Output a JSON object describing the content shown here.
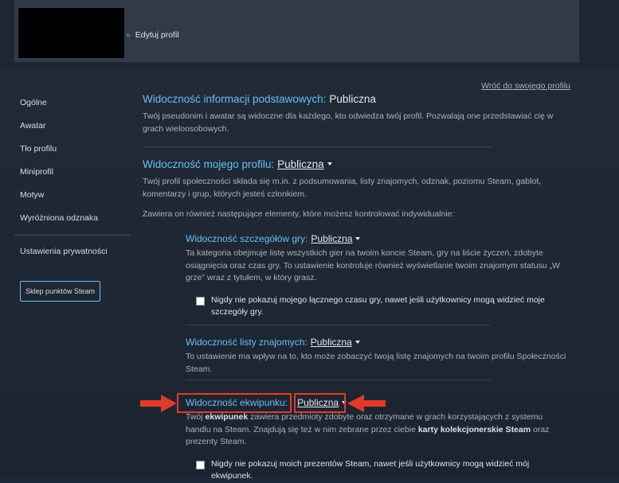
{
  "header": {
    "breadcrumb_sep": "»",
    "breadcrumb": "Edytuj profil"
  },
  "back_link": "Wróć do swojego profilu",
  "sidebar": {
    "items": [
      {
        "label": "Ogólne"
      },
      {
        "label": "Awatar"
      },
      {
        "label": "Tło profilu"
      },
      {
        "label": "Miniprofil"
      },
      {
        "label": "Motyw"
      },
      {
        "label": "Wyróżniona odznaka"
      }
    ],
    "privacy": "Ustawienia prywatności",
    "store_button": "Sklep punktów Steam"
  },
  "sections": {
    "basic": {
      "title": "Widoczność informacji podstawowych:",
      "value": "Publiczna",
      "desc": "Twój pseudonim i awatar są widoczne dla każdego, kto odwiedza twój profil. Pozwalają one przedstawiać cię w grach wieloosobowych."
    },
    "profile": {
      "title": "Widoczność mojego profilu:",
      "value": "Publiczna",
      "desc": "Twój profil społeczności składa się m.in. z podsumowania, listy znajomych, odznak, poziomu Steam, gablot, komentarzy i grup, których jesteś członkiem.",
      "note": "Zawiera on również następujące elementy, które możesz kontrolować indywidualnie:"
    },
    "game_details": {
      "title": "Widoczność szczegółów gry:",
      "value": "Publiczna",
      "desc": "Ta kategoria obejmuje listę wszystkich gier na twoim koncie Steam, gry na liście życzeń, zdobyte osiągnięcia oraz czas gry. To ustawienie kontroluje również wyświetlanie twoim znajomym statusu „W grze” wraz z tytułem, w który grasz.",
      "checkbox": "Nigdy nie pokazuj mojego łącznego czasu gry, nawet jeśli użytkownicy mogą widzieć moje szczegóły gry."
    },
    "friends": {
      "title": "Widoczność listy znajomych:",
      "value": "Publiczna",
      "desc": "To ustawienie ma wpływ na to, kto może zobaczyć twoją listę znajomych na twoim profilu Społeczności Steam."
    },
    "inventory": {
      "title": "Widoczność ekwipunku:",
      "value": "Publiczna",
      "desc_pre": "Twój ",
      "desc_bold1": "ekwipunek",
      "desc_mid": " zawiera przedmioty zdobyte oraz otrzymane w grach korzystających z systemu handlu na Steam. Znajdują się też w nim zebrane przez ciebie ",
      "desc_bold2": "karty kolekcjonerskie Steam",
      "desc_post": " oraz prezenty Steam.",
      "checkbox": "Nigdy nie pokazuj moich prezentów Steam, nawet jeśli użytkownicy mogą widzieć mój ekwipunek."
    }
  },
  "colors": {
    "background": "#1b2838",
    "accent_blue": "#66c0f4",
    "annotation_red": "#e23a2a"
  }
}
